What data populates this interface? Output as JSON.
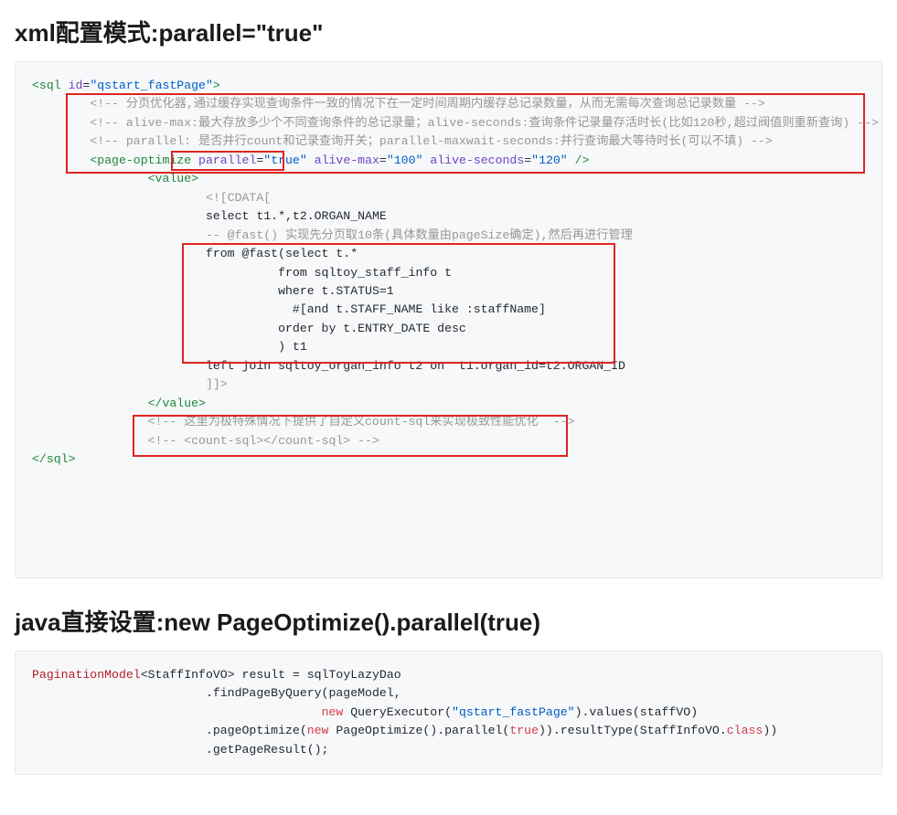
{
  "headings": {
    "h1_xml": "xml配置模式:parallel=\"true\"",
    "h1_java": "java直接设置:new PageOptimize().parallel(true)"
  },
  "xml": {
    "open_tag_sql": "sql",
    "sql_id_attr": "id",
    "sql_id_val": "\"qstart_fastPage\"",
    "cmt1": "<!-- 分页优化器,通过缓存实现查询条件一致的情况下在一定时间周期内缓存总记录数量，从而无需每次查询总记录数量 -->",
    "cmt2": "<!-- alive-max:最大存放多少个不同查询条件的总记录量；alive-seconds:查询条件记录量存活时长(比如120秒,超过阀值则重新查询) -->",
    "cmt3": "<!-- parallel: 是否并行count和记录查询开关；parallel-maxwait-seconds:并行查询最大等待时长(可以不填) -->",
    "pgo_tag": "page-optimize",
    "pgo_parallel_attr": "parallel",
    "pgo_parallel_val": "\"true\"",
    "pgo_alivemax_attr": "alive-max",
    "pgo_alivemax_val": "\"100\"",
    "pgo_alivesec_attr": "alive-seconds",
    "pgo_alivesec_val": "\"120\"",
    "value_tag": "value",
    "cdata_open": "<![CDATA[",
    "l_select": "select t1.*,t2.ORGAN_NAME",
    "l_fastcmt": "-- @fast() 实现先分页取10条(具体数量由pageSize确定),然后再进行管理",
    "l_from": "from @fast(select t.*",
    "l_from2": "from sqltoy_staff_info t",
    "l_where": "where t.STATUS=1",
    "l_opt": "#[and t.STAFF_NAME like :staffName]",
    "l_order": "order by t.ENTRY_DATE desc",
    "l_close": ") t1",
    "l_join": "left join sqltoy_organ_info t2 on  t1.organ_id=t2.ORGAN_ID",
    "cdata_close": "]]>",
    "cmt4": "<!-- 这里为极特殊情况下提供了自定义count-sql来实现极致性能优化  -->",
    "cmt5": "<!-- <count-sql></count-sql> -->"
  },
  "java": {
    "type_paginationmodel": "PaginationModel",
    "type_staffinfovo": "StaffInfoVO",
    "var_result": " result = sqlToyLazyDao",
    "l2": ".findPageByQuery(pageModel,",
    "kw_new": "new",
    "type_queryexecutor": " QueryExecutor",
    "str_qname": "\"qstart_fastPage\"",
    "txt_values": ").values(staffVO)",
    "l4a": ".pageOptimize(",
    "type_pageoptimize": " PageOptimize",
    "txt_parallel": "().parallel(",
    "kw_true": "true",
    "txt_resultType_a": ")).resultType(StaffInfoVO.",
    "kw_class": "class",
    "txt_resultType_b": "))",
    "l5": ".getPageResult();"
  }
}
